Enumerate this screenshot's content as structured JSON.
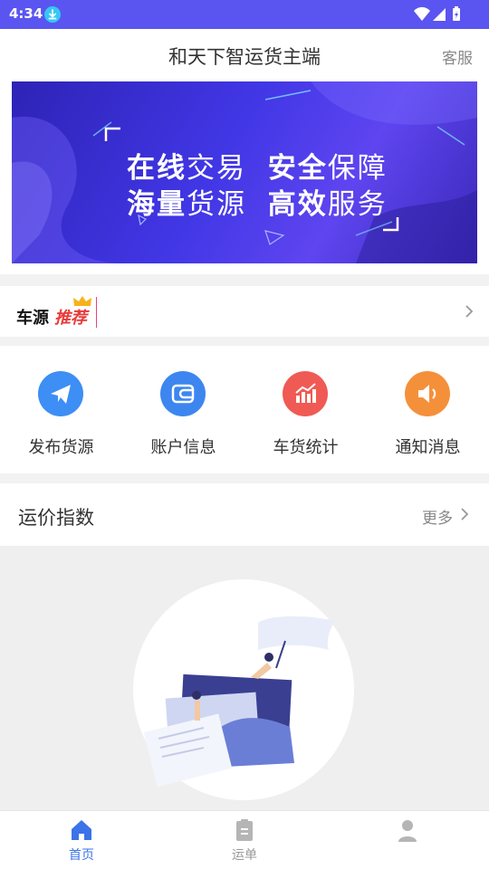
{
  "status_bar": {
    "time": "4:34"
  },
  "header": {
    "title": "和天下智运货主端",
    "service_label": "客服"
  },
  "banner": {
    "line1": [
      {
        "bold": "在线",
        "normal": "交易"
      },
      {
        "bold": "安全",
        "normal": "保障"
      }
    ],
    "line2": [
      {
        "bold": "海量",
        "normal": "货源"
      },
      {
        "bold": "高效",
        "normal": "服务"
      }
    ]
  },
  "recommend": {
    "label": "车源",
    "tag": "推荐"
  },
  "menu": {
    "items": [
      {
        "label": "发布货源",
        "icon": "paper-plane-icon",
        "color": "#3d8ef5"
      },
      {
        "label": "账户信息",
        "icon": "wallet-icon",
        "color": "#3d86f0"
      },
      {
        "label": "车货统计",
        "icon": "chart-icon",
        "color": "#f05a55"
      },
      {
        "label": "通知消息",
        "icon": "speaker-icon",
        "color": "#f5903a"
      }
    ]
  },
  "freight_index": {
    "title": "运价指数",
    "more_label": "更多"
  },
  "tabbar": {
    "tabs": [
      {
        "label": "首页",
        "icon": "home-icon",
        "active": true
      },
      {
        "label": "运单",
        "icon": "clipboard-icon",
        "active": false
      },
      {
        "label": "",
        "icon": "user-icon",
        "active": false
      }
    ]
  },
  "colors": {
    "status_bar": "#5a55f0",
    "accent": "#3b73e8",
    "tag": "#e83a3a"
  }
}
